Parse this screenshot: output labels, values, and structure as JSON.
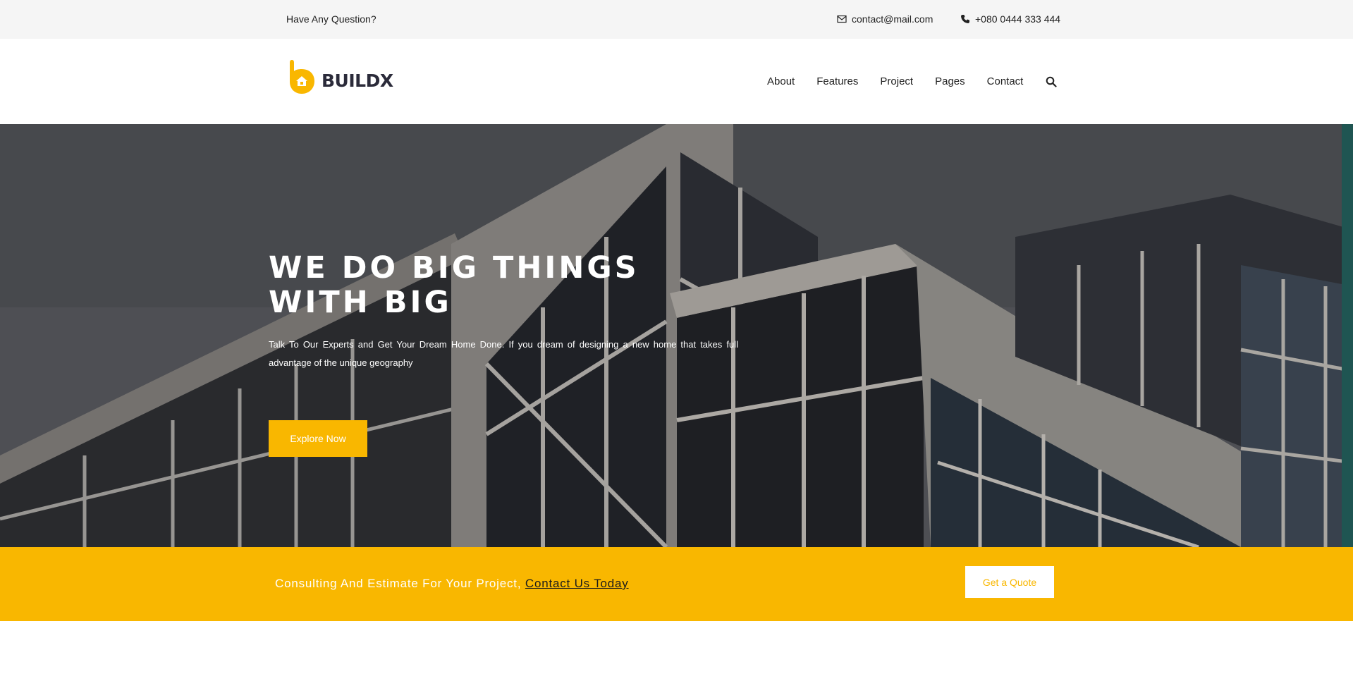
{
  "topbar": {
    "question": "Have Any Question?",
    "email": "contact@mail.com",
    "phone": "+080 0444 333 444"
  },
  "header": {
    "logo_text": "BUILDX",
    "nav": [
      {
        "label": "About"
      },
      {
        "label": "Features"
      },
      {
        "label": "Project"
      },
      {
        "label": "Pages"
      },
      {
        "label": "Contact"
      }
    ],
    "search_icon": "search-icon"
  },
  "hero": {
    "title_line1": "WE DO BIG THINGS",
    "title_line2": "WITH BIG",
    "description": "Talk To Our Experts and Get Your Dream Home Done. If you dream of designing a new home that takes full advantage of the unique geography",
    "button_label": "Explore Now"
  },
  "cta": {
    "text": "Consulting And Estimate For Your Project, ",
    "link_label": "Contact Us Today",
    "button_label": "Get a Quote"
  },
  "colors": {
    "accent": "#f9b700",
    "topbar_bg": "#f5f5f5",
    "dark_text": "#2b2b3a"
  }
}
